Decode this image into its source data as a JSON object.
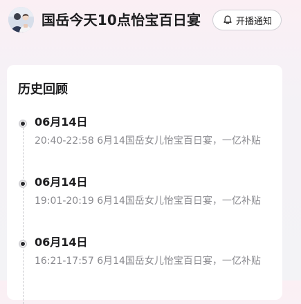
{
  "header": {
    "title": "国岳今天10点怡宝百日宴",
    "avatar_icon": "avatar-photo",
    "notify_button": {
      "icon": "bell-icon",
      "label": "开播通知"
    }
  },
  "history": {
    "section_title": "历史回顾",
    "items": [
      {
        "date": "06月14日",
        "description": "20:40-22:58 6月14国岳女儿怡宝百日宴，一亿补贴"
      },
      {
        "date": "06月14日",
        "description": "19:01-20:19 6月14国岳女儿怡宝百日宴，一亿补贴"
      },
      {
        "date": "06月14日",
        "description": "16:21-17:57 6月14国岳女儿怡宝百日宴，一亿补贴"
      }
    ]
  },
  "colors": {
    "text_primary": "#1c1c1e",
    "text_secondary": "#8a8a8f",
    "background_tint": "#fbeff4",
    "card": "#ffffff"
  }
}
